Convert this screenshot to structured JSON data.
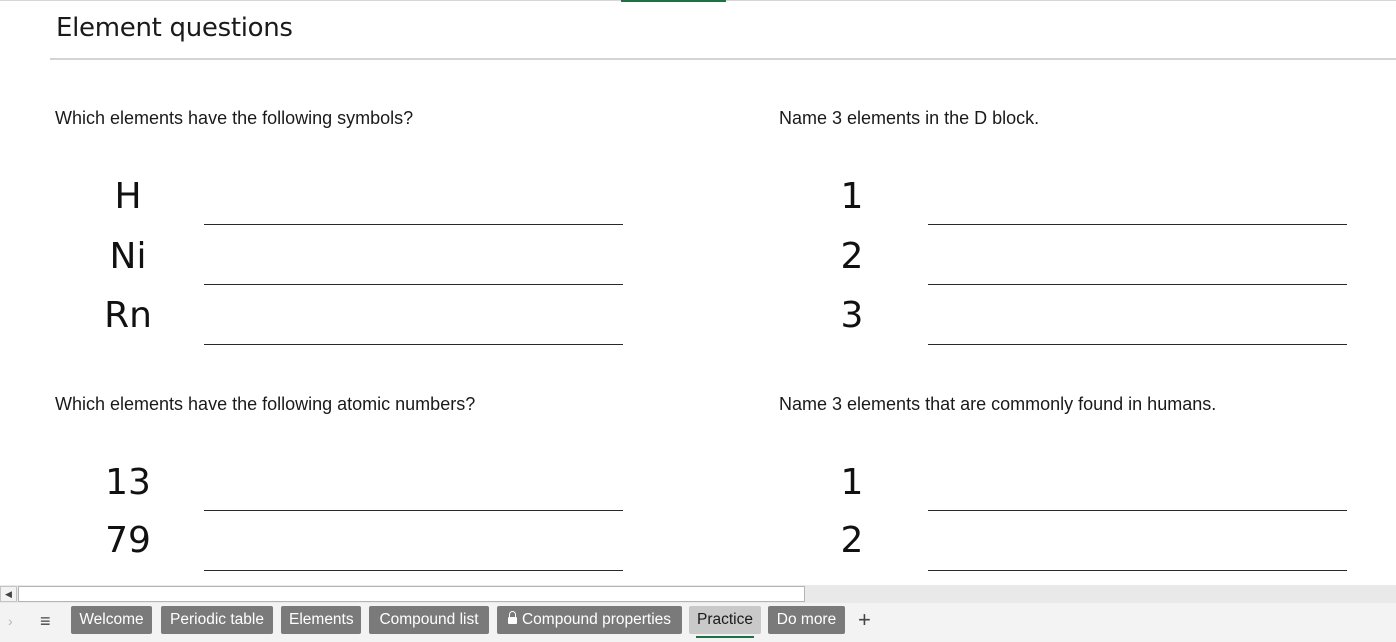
{
  "sheet": {
    "title": "Element questions"
  },
  "sections": {
    "symbols": {
      "question": "Which elements have the following symbols?",
      "rows": [
        "H",
        "Ni",
        "Rn"
      ]
    },
    "dblock": {
      "question": "Name 3 elements in the D block.",
      "rows": [
        "1",
        "2",
        "3"
      ]
    },
    "atomic": {
      "question": "Which elements have the following atomic numbers?",
      "rows": [
        "13",
        "79"
      ]
    },
    "humans": {
      "question": "Name 3 elements that are commonly found in humans.",
      "rows": [
        "1",
        "2"
      ]
    }
  },
  "scrollbar": {
    "left_arrow": "◀"
  },
  "tabs": {
    "nav_icon": "chevron-right-icon",
    "all_sheets_icon": "hamburger-icon",
    "all_sheets_glyph": "≡",
    "nav_glyph": "›",
    "items": [
      {
        "label": "Welcome",
        "active": false,
        "locked": false
      },
      {
        "label": "Periodic table",
        "active": false,
        "locked": false
      },
      {
        "label": "Elements",
        "active": false,
        "locked": false
      },
      {
        "label": "Compound list",
        "active": false,
        "locked": false
      },
      {
        "label": "Compound properties",
        "active": false,
        "locked": true
      },
      {
        "label": "Practice",
        "active": true,
        "locked": false
      },
      {
        "label": "Do more",
        "active": false,
        "locked": false
      }
    ],
    "add_glyph": "+"
  },
  "colors": {
    "accent": "#1e7145",
    "tab_bg": "#7a7a7a",
    "tab_active_bg": "#c9c9c9"
  }
}
